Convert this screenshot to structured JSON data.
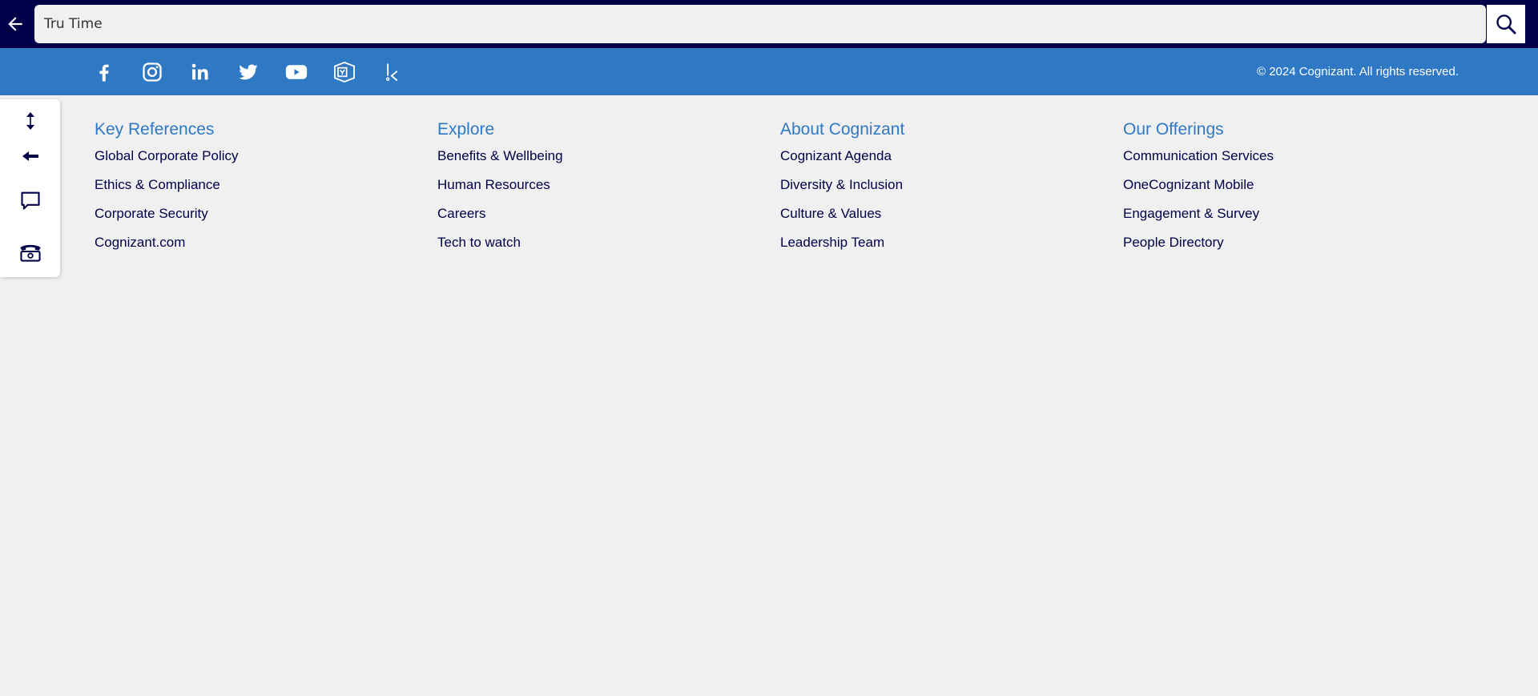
{
  "search": {
    "value": "Tru Time",
    "back_icon": "arrow-left-icon",
    "search_icon": "search-icon"
  },
  "social": {
    "icons": [
      "facebook-icon",
      "instagram-icon",
      "linkedin-icon",
      "twitter-icon",
      "youtube-icon",
      "yammer-icon",
      "kanvas-icon"
    ],
    "copyright": "© 2024 Cognizant. All rights reserved."
  },
  "tools": [
    "expand-collapse-icon",
    "back-arrow-icon",
    "chat-icon",
    "support-phone-icon"
  ],
  "footer": {
    "columns": [
      {
        "title": "Key References",
        "links": [
          "Global Corporate Policy",
          "Ethics & Compliance",
          "Corporate Security",
          "Cognizant.com"
        ]
      },
      {
        "title": "Explore",
        "links": [
          "Benefits & Wellbeing",
          "Human Resources",
          "Careers",
          "Tech to watch"
        ]
      },
      {
        "title": "About Cognizant",
        "links": [
          "Cognizant Agenda",
          "Diversity & Inclusion",
          "Culture & Values",
          "Leadership Team"
        ]
      },
      {
        "title": "Our Offerings",
        "links": [
          "Communication Services",
          "OneCognizant Mobile",
          "Engagement & Survey",
          "People Directory"
        ]
      }
    ]
  },
  "colors": {
    "navy": "#000048",
    "blue": "#2f78c4",
    "background": "#f0f0f0"
  }
}
